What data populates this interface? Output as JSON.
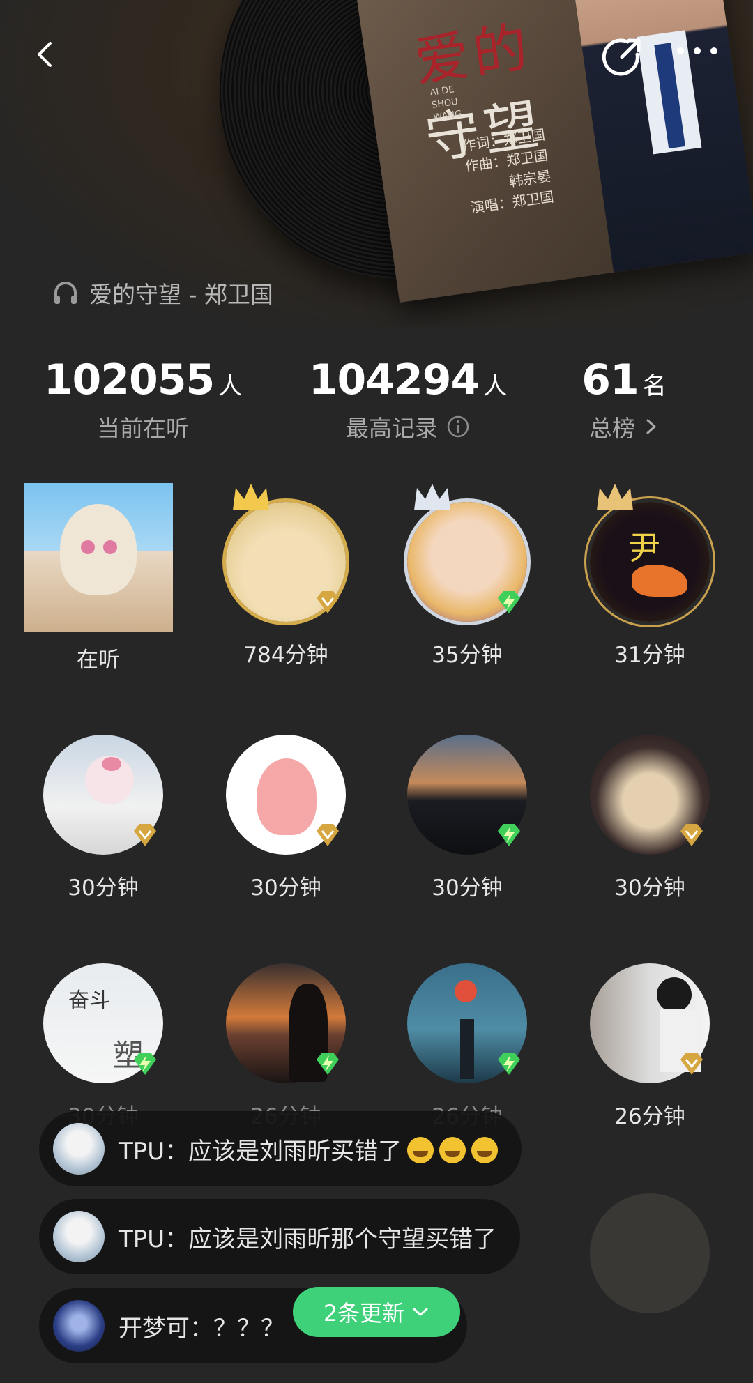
{
  "song": {
    "title": "爱的守望 - 郑卫国"
  },
  "album": {
    "title_part1": "爱的",
    "title_part2": "守望",
    "pinyin": "AI DE SHOU WANG",
    "credit_lyric": "作词：郑卫国",
    "credit_music": "作曲：郑卫国",
    "credit_music2": "韩宗晏",
    "credit_singer": "演唱：郑卫国"
  },
  "stats": [
    {
      "num": "102055",
      "unit": "人",
      "label": "当前在听"
    },
    {
      "num": "104294",
      "unit": "人",
      "label": "最高记录"
    },
    {
      "num": "61",
      "unit": "名",
      "label": "总榜"
    }
  ],
  "listeners": [
    {
      "label": "在听"
    },
    {
      "label": "784分钟"
    },
    {
      "label": "35分钟"
    },
    {
      "label": "31分钟"
    },
    {
      "label": "30分钟"
    },
    {
      "label": "30分钟"
    },
    {
      "label": "30分钟"
    },
    {
      "label": "30分钟"
    },
    {
      "label": "30分钟"
    },
    {
      "label": "26分钟"
    },
    {
      "label": "26分钟"
    },
    {
      "label": "26分钟"
    }
  ],
  "avatar_texts": {
    "l8_top": "奋斗",
    "l8_mid": "塑",
    "l3_char": "尹"
  },
  "comments": [
    {
      "user": "TPU",
      "text": "TPU：应该是刘雨昕买错了"
    },
    {
      "user": "TPU",
      "text": "TPU：应该是刘雨昕那个守望买错了"
    },
    {
      "user": "开梦可",
      "text": "开梦可：？？？"
    }
  ],
  "update_pill": {
    "label": "2条更新"
  },
  "colors": {
    "accent": "#3fd07a",
    "background": "#262626",
    "gold": "#d4ac4c",
    "vip_green": "#3fcf5a"
  }
}
